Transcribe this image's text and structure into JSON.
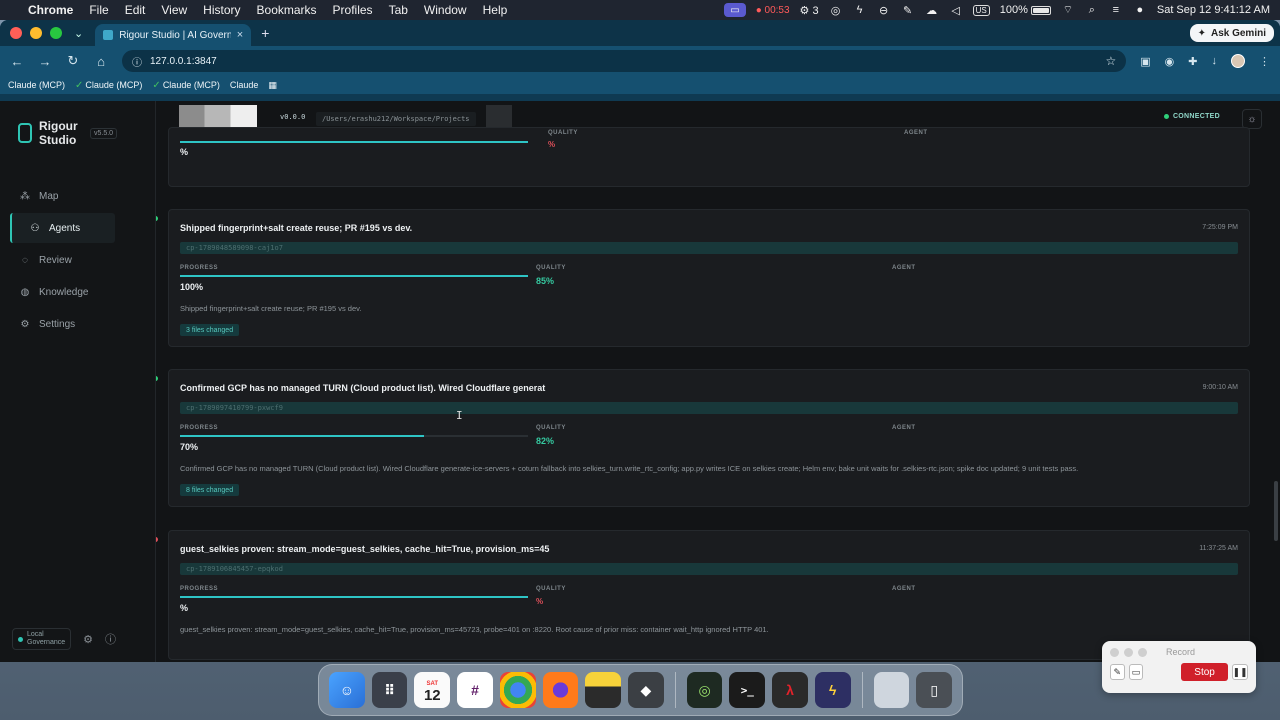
{
  "menubar": {
    "app": "Chrome",
    "items": [
      "File",
      "Edit",
      "View",
      "History",
      "Bookmarks",
      "Profiles",
      "Tab",
      "Window",
      "Help"
    ],
    "timer": "00:53",
    "notif_count": "3",
    "battery": "100%",
    "input_source": "US",
    "datetime": "Sat Sep 12  9:41:12 AM"
  },
  "browser": {
    "tab_title": "Rigour Studio | AI Governance",
    "url": "127.0.0.1:3847",
    "ask_gemini": "Ask Gemini",
    "bookmarks": [
      {
        "label": "Claude (MCP)",
        "check": false
      },
      {
        "label": "Claude (MCP)",
        "check": true
      },
      {
        "label": "Claude (MCP)",
        "check": true
      },
      {
        "label": "Claude",
        "check": false
      }
    ]
  },
  "app": {
    "brand": "Rigour Studio",
    "version": "v5.5.0",
    "nav": [
      {
        "label": "Map",
        "icon": "map-icon"
      },
      {
        "label": "Agents",
        "icon": "agents-icon",
        "active": true
      },
      {
        "label": "Review",
        "icon": "review-icon"
      },
      {
        "label": "Knowledge",
        "icon": "knowledge-icon"
      },
      {
        "label": "Settings",
        "icon": "settings-icon"
      }
    ],
    "footer": {
      "gov_label_1": "Local",
      "gov_label_2": "Governance"
    },
    "topbar": {
      "version": "v0.0.0",
      "path": "/Users/erashu212/Workspace/Projects",
      "status": "CONNECTED"
    },
    "labels": {
      "progress": "PROGRESS",
      "quality": "QUALITY",
      "agent": "AGENT"
    },
    "cards": [
      {
        "title": "",
        "time": "",
        "cp": "",
        "progress": "%",
        "progress_fill": 1.0,
        "quality": "%",
        "quality_bad": true,
        "summary": "",
        "files": ""
      },
      {
        "title": "Shipped fingerprint+salt create reuse; PR #195 vs dev.",
        "time": "7:25:09 PM",
        "cp": "cp-1789048589098-caj1o7",
        "progress": "100%",
        "progress_fill": 1.0,
        "quality": "85%",
        "quality_bad": false,
        "summary": "Shipped fingerprint+salt create reuse; PR #195 vs dev.",
        "files": "3 files changed"
      },
      {
        "title": "Confirmed GCP has no managed TURN (Cloud product list). Wired Cloudflare generat",
        "time": "9:00:10 AM",
        "cp": "cp-1789097410799-pxwcf9",
        "progress": "70%",
        "progress_fill": 0.7,
        "quality": "82%",
        "quality_bad": false,
        "summary": "Confirmed GCP has no managed TURN (Cloud product list). Wired Cloudflare generate-ice-servers + coturn fallback into selkies_turn.write_rtc_config; app.py writes ICE on selkies create; Helm env; bake unit waits for .selkies-rtc.json; spike doc updated; 9 unit tests pass.",
        "files": "8 files changed"
      },
      {
        "title": "guest_selkies proven: stream_mode=guest_selkies, cache_hit=True, provision_ms=45",
        "time": "11:37:25 AM",
        "cp": "cp-1789106845457-epqkod",
        "progress": "%",
        "progress_fill": 1.0,
        "quality": "%",
        "quality_bad": true,
        "summary": "guest_selkies proven: stream_mode=guest_selkies, cache_hit=True, provision_ms=45723, probe=401 on :8220. Root cause of prior miss: container wait_http ignored HTTP 401.",
        "files": ""
      }
    ]
  },
  "dock": {
    "calendar_day": "12",
    "calendar_month": "SAT"
  },
  "recorder": {
    "title": "Record",
    "stop": "Stop"
  },
  "colors": {
    "accent": "#2fc5b4",
    "progress": "#2ec4c5",
    "quality": "#35c9a0",
    "bad": "#e0505a"
  }
}
